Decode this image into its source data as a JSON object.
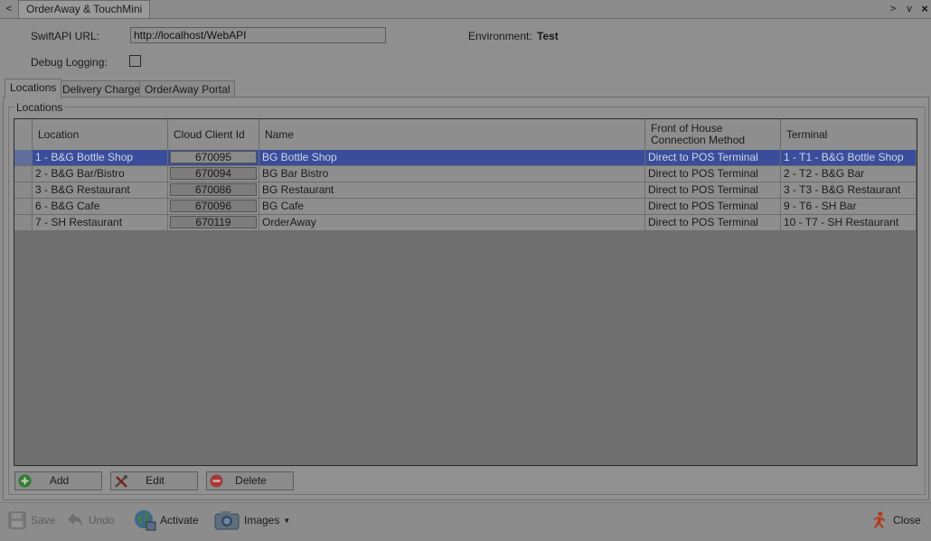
{
  "window": {
    "tab_title": "OrderAway & TouchMini",
    "nav_left": "<",
    "nav_right": ">",
    "nav_menu": "v",
    "nav_close": "×"
  },
  "settings": {
    "swiftapi_label": "SwiftAPI URL:",
    "swiftapi_value": "http://localhost/WebAPI",
    "debug_label": "Debug Logging:",
    "debug_checked": false,
    "environment_label": "Environment:",
    "environment_value": "Test"
  },
  "tabs": [
    {
      "label": "Locations",
      "active": true
    },
    {
      "label": "Delivery Charges",
      "active": false
    },
    {
      "label": "OrderAway Portal",
      "active": false
    }
  ],
  "locations": {
    "group_title": "Locations",
    "columns": [
      "Location",
      "Cloud Client Id",
      "Name",
      "Front of House\nConnection Method",
      "Terminal"
    ],
    "rows": [
      {
        "location": "1 - B&G Bottle Shop",
        "client_id": "670095",
        "name": "BG Bottle Shop",
        "method": "Direct to POS Terminal",
        "terminal": "1 - T1 - B&G Bottle Shop",
        "selected": true
      },
      {
        "location": "2 - B&G Bar/Bistro",
        "client_id": "670094",
        "name": "BG Bar Bistro",
        "method": "Direct to POS Terminal",
        "terminal": "2 - T2 - B&G Bar",
        "selected": false
      },
      {
        "location": "3 - B&G Restaurant",
        "client_id": "670086",
        "name": "BG Restaurant",
        "method": "Direct to POS Terminal",
        "terminal": "3 - T3 - B&G Restaurant",
        "selected": false
      },
      {
        "location": "6 - B&G Cafe",
        "client_id": "670096",
        "name": "BG Cafe",
        "method": "Direct to POS Terminal",
        "terminal": "9 - T6 - SH Bar",
        "selected": false
      },
      {
        "location": "7 - SH Restaurant",
        "client_id": "670119",
        "name": "OrderAway",
        "method": "Direct to POS Terminal",
        "terminal": "10 - T7 - SH Restaurant",
        "selected": false
      }
    ],
    "buttons": {
      "add": "Add",
      "edit": "Edit",
      "delete": "Delete"
    }
  },
  "toolbar": {
    "save": "Save",
    "undo": "Undo",
    "activate": "Activate",
    "images": "Images",
    "close": "Close"
  },
  "colors": {
    "selection": "#3a4d9a",
    "add_icon": "#2e7a2e",
    "delete_icon": "#a33a3a",
    "close_icon": "#b23a1e"
  }
}
